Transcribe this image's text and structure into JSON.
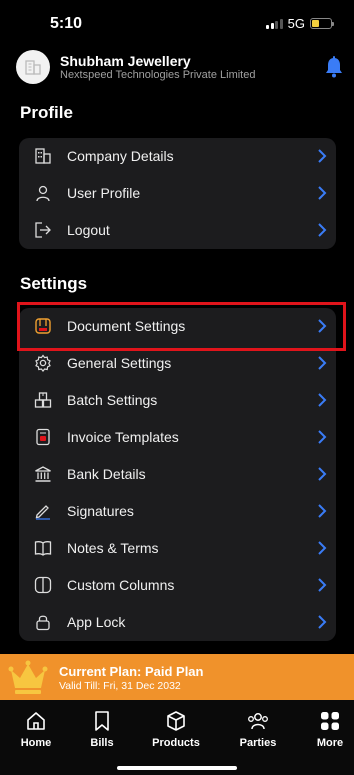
{
  "status_bar": {
    "time": "5:10",
    "network": "5G"
  },
  "header": {
    "company_name": "Shubham Jewellery",
    "company_subtitle": "Nextspeed Technologies Private Limited"
  },
  "profile": {
    "title": "Profile",
    "items": [
      {
        "label": "Company Details",
        "icon": "building-icon"
      },
      {
        "label": "User Profile",
        "icon": "user-icon"
      },
      {
        "label": "Logout",
        "icon": "logout-icon"
      }
    ]
  },
  "settings": {
    "title": "Settings",
    "items": [
      {
        "label": "Document Settings",
        "icon": "document-settings-icon"
      },
      {
        "label": "General Settings",
        "icon": "gear-icon"
      },
      {
        "label": "Batch Settings",
        "icon": "boxes-icon"
      },
      {
        "label": "Invoice Templates",
        "icon": "invoice-icon"
      },
      {
        "label": "Bank Details",
        "icon": "bank-icon"
      },
      {
        "label": "Signatures",
        "icon": "pen-icon"
      },
      {
        "label": "Notes & Terms",
        "icon": "book-icon"
      },
      {
        "label": "Custom Columns",
        "icon": "columns-icon"
      },
      {
        "label": "App Lock",
        "icon": "lock-icon"
      }
    ]
  },
  "plan": {
    "title": "Current Plan: Paid Plan",
    "valid_till": "Valid Till: Fri, 31 Dec 2032"
  },
  "tabs": [
    {
      "label": "Home",
      "icon": "home-icon"
    },
    {
      "label": "Bills",
      "icon": "bookmark-icon"
    },
    {
      "label": "Products",
      "icon": "cube-icon"
    },
    {
      "label": "Parties",
      "icon": "people-icon"
    },
    {
      "label": "More",
      "icon": "grid-icon"
    }
  ],
  "colors": {
    "accent_blue": "#3a7cf6",
    "highlight_red": "#e0141b",
    "plan_orange": "#f0922b",
    "card_bg": "#1c1c1e"
  }
}
